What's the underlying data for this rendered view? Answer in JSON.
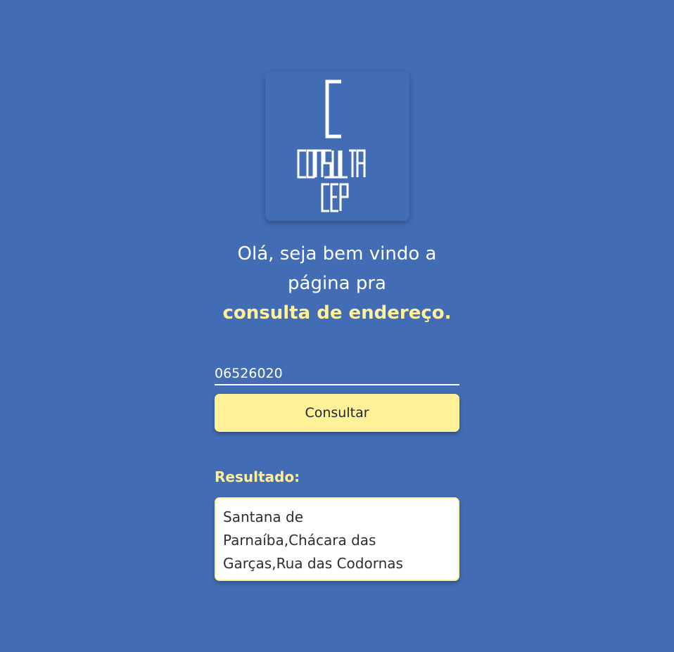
{
  "logo": {
    "line1": "CONSULTA",
    "line2": "CEP"
  },
  "greeting": {
    "line1": "Olá, seja bem vindo a",
    "line2": "página pra",
    "accent": "consulta de endereço."
  },
  "form": {
    "cep_value": "06526020",
    "button_label": "Consultar"
  },
  "result": {
    "label": "Resultado:",
    "lines": [
      "Santana de",
      "Parnaíba,Chácara das",
      "Garças,Rua das Codornas"
    ]
  },
  "colors": {
    "background": "#426cb4",
    "accent_yellow": "#fff198",
    "text_dark": "#1f2630"
  }
}
